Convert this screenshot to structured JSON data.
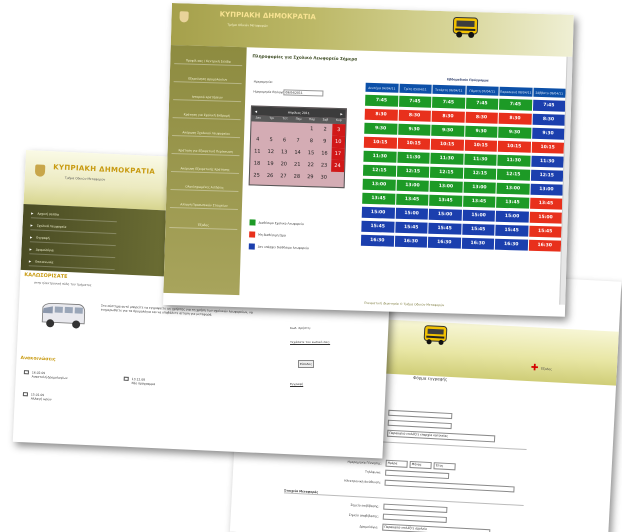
{
  "back_form": {
    "form_title": "Φόρμα εγγραφής",
    "close_label": "Έξοδος",
    "rows": [
      {
        "label": "Όνομα:"
      },
      {
        "label": "Επίθετο:"
      },
      {
        "label": "Επαρχία:",
        "select": "Παρακαλώ επιλέξτε επαρχία κατοικίας"
      },
      {
        "label": "Διεύθυνση κατοικίας"
      },
      {
        "label": "Ημερομηνία Γέννησης:",
        "d1": "Ημέρα",
        "d2": "Μήνας",
        "d3": "Έτος"
      },
      {
        "label": "Τηλέφωνο:"
      },
      {
        "label": "Ηλεκτρονική διεύθυνση:"
      }
    ],
    "section2": "Στοιχεία Μεταφοράς",
    "rows2": [
      {
        "label": "Σημείο επιβίβασης:"
      },
      {
        "label": "Σημείο αποβίβασης:"
      },
      {
        "label": "Δρομολόγιο:",
        "select": "Παρακαλώ επιλέξτε σχολείο"
      }
    ]
  },
  "portal": {
    "org": "ΚΥΠΡΙΑΚΗ ΔΗΜΟΚΡΑΤΙΑ",
    "sub": "Τμήμα Οδικών Μεταφορών",
    "nav": [
      "Αρχική σελίδα",
      "Σχολικά Λεωφορεία",
      "Εγγραφή",
      "Δρομολόγια",
      "Επικοινωνία"
    ],
    "content_title": "ΚΑΛΩΣΟΡΙΣΑΤΕ",
    "content_sub": "στην ηλεκτρονική πύλη του τμήματος",
    "intro": "Στο σύστημα αυτό μπορείτε να εγγραφείτε ως χρήστης για τη χρήση των σχολικών λεωφορείων, να ενημερωθείτε για τα δρομολόγια και να υποβάλετε αίτηση για μεταφορά.",
    "ann_title": "Ανακοινώσεις",
    "announcements": [
      {
        "date": "16.02.09",
        "text": "Αναστολή δρομολογίων"
      },
      {
        "date": "15.01.09",
        "text": "Αλλαγή ωρών"
      },
      {
        "date": "13.12.08",
        "text": "Νέο πρόγραμμα"
      }
    ]
  },
  "fragment": {
    "login_label": "Κωδ. Χρήστη:",
    "forgot_label": "Ξεχάσατε τον κωδικό σας;",
    "button_label": "Είσοδος",
    "register_label": "Εγγραφή"
  },
  "booking": {
    "org": "ΚΥΠΡΙΑΚΗ ΔΗΜΟΚΡΑΤΙΑ",
    "sub": "Τμήμα Οδικών Μεταφορών",
    "side_menu": [
      "Προφίλ σας / Κεντρική Σελίδα",
      "Εξερεύνηση Δρομολογίων",
      "Ιστορικό κρατήσεων",
      "Κράτηση για Σχολική Εκδρομή",
      "Ακύρωση Σχολικού Λεωφορείου",
      "Κράτηση για Εξαιρετική Περίπτωση",
      "Ακύρωση Εξαιρετικής Κράτησης",
      "Ολοκληρωμένες Αιτήσεις",
      "Αλλαγή Προσωπικών Στοιχείων",
      "Έξοδος"
    ],
    "title": "Πληροφορίες για Σχολικό Λεωφορείο Σήμερα",
    "field1": "Ημερομηνία:",
    "field2": "Ημερομηνία Επιλογής:",
    "field2_value": "09/04/2011",
    "calendar": {
      "month": "Απρίλιος 2011",
      "dow": [
        "Δευ",
        "Τρι",
        "Τετ",
        "Πεμ",
        "Παρ",
        "Σαβ",
        "Κυρ"
      ],
      "days": [
        "",
        "",
        "",
        "",
        "1",
        "2",
        "3",
        "4",
        "5",
        "6",
        "7",
        "8",
        "9",
        "10",
        "11",
        "12",
        "13",
        "14",
        "15",
        "16",
        "17",
        "18",
        "19",
        "20",
        "21",
        "22",
        "23",
        "24",
        "25",
        "26",
        "27",
        "28",
        "29",
        "30",
        ""
      ]
    },
    "legend": [
      {
        "color": "#1d9a26",
        "text": "Διαθέσιμο Σχολικό Λεωφορείο"
      },
      {
        "color": "#e8301c",
        "text": "Μη διαθέσιμη Ώρα"
      },
      {
        "color": "#1b3fae",
        "text": "Δεν υπάρχει διαθέσιμο λεωφορείο"
      }
    ],
    "schedule_title": "Εβδομαδιαίο Πρόγραμμα",
    "days_hdr": [
      "Δευτέρα 04/04/11",
      "Τρίτη 05/04/11",
      "Τετάρτη 06/04/11",
      "Πέμπτη 07/04/11",
      "Παρασκευή 08/04/11",
      "Σάββατο 09/04/11"
    ],
    "schedule": [
      {
        "time": "7:45",
        "c": [
          "g",
          "g",
          "g",
          "g",
          "g",
          "b"
        ]
      },
      {
        "time": "8:30",
        "c": [
          "r",
          "r",
          "r",
          "r",
          "r",
          "b"
        ]
      },
      {
        "time": "9:30",
        "c": [
          "g",
          "g",
          "g",
          "g",
          "g",
          "b"
        ]
      },
      {
        "time": "10:15",
        "c": [
          "r",
          "r",
          "r",
          "r",
          "r",
          "r"
        ]
      },
      {
        "time": "11:30",
        "c": [
          "g",
          "g",
          "g",
          "g",
          "g",
          "b"
        ]
      },
      {
        "time": "12:15",
        "c": [
          "g",
          "g",
          "g",
          "g",
          "g",
          "b"
        ]
      },
      {
        "time": "13:00",
        "c": [
          "g",
          "g",
          "g",
          "g",
          "g",
          "b"
        ]
      },
      {
        "time": "13:45",
        "c": [
          "g",
          "g",
          "g",
          "g",
          "g",
          "r"
        ]
      },
      {
        "time": "15:00",
        "c": [
          "b",
          "b",
          "b",
          "b",
          "b",
          "r"
        ]
      },
      {
        "time": "15:45",
        "c": [
          "b",
          "b",
          "b",
          "b",
          "b",
          "r"
        ]
      },
      {
        "time": "16:30",
        "c": [
          "b",
          "b",
          "b",
          "b",
          "b",
          "r"
        ]
      }
    ],
    "footer": "Πνευματική ιδιοκτησία © Τμήμα Οδικών Μεταφορών"
  }
}
